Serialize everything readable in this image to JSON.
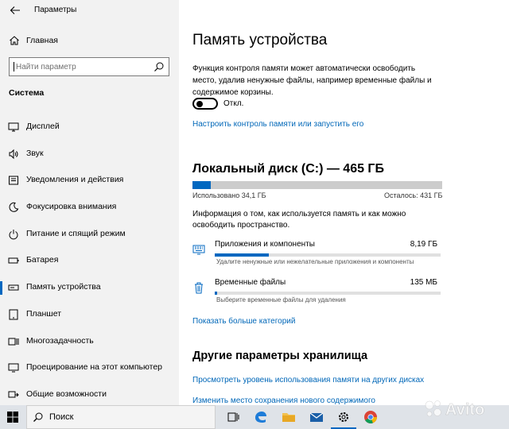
{
  "window": {
    "title": "Параметры"
  },
  "sidebar": {
    "home_label": "Главная",
    "search_placeholder": "Найти параметр",
    "section_label": "Система",
    "items": [
      {
        "label": "Дисплей",
        "icon": "display-icon"
      },
      {
        "label": "Звук",
        "icon": "speaker-icon"
      },
      {
        "label": "Уведомления и действия",
        "icon": "notification-icon"
      },
      {
        "label": "Фокусировка внимания",
        "icon": "moon-icon"
      },
      {
        "label": "Питание и спящий режим",
        "icon": "power-icon"
      },
      {
        "label": "Батарея",
        "icon": "battery-icon"
      },
      {
        "label": "Память устройства",
        "icon": "storage-icon",
        "active": true
      },
      {
        "label": "Планшет",
        "icon": "tablet-icon"
      },
      {
        "label": "Многозадачность",
        "icon": "multitask-icon"
      },
      {
        "label": "Проецирование на этот компьютер",
        "icon": "project-icon"
      },
      {
        "label": "Общие возможности",
        "icon": "shared-icon"
      }
    ]
  },
  "main": {
    "title": "Память устройства",
    "description": "Функция контроля памяти может автоматически освободить место, удалив ненужные файлы, например временные файлы и содержимое корзины.",
    "toggle": {
      "state": "off",
      "label": "Откл."
    },
    "configure_link": "Настроить контроль памяти или запустить его",
    "disk": {
      "title": "Локальный диск (C:) — 465 ГБ",
      "used_label": "Использовано 34,1 ГБ",
      "free_label": "Осталось: 431 ГБ",
      "used_fraction": 0.073
    },
    "info": "Информация о том, как используется память и как можно освободить пространство.",
    "categories": [
      {
        "name": "Приложения и компоненты",
        "size": "8,19 ГБ",
        "sub": "Удалите ненужные или нежелательные приложения и компоненты",
        "fraction": 0.24,
        "icon": "apps-icon"
      },
      {
        "name": "Временные файлы",
        "size": "135 МБ",
        "sub": "Выберите временные файлы для удаления",
        "fraction": 0.01,
        "icon": "trash-icon"
      }
    ],
    "more_link": "Показать больше категорий",
    "other_title": "Другие параметры хранилища",
    "other_links": [
      "Просмотреть уровень использования памяти на других дисках",
      "Изменить место сохранения нового содержимого"
    ]
  },
  "taskbar": {
    "search_label": "Поиск",
    "icons": [
      "task-view-icon",
      "edge-icon",
      "file-explorer-icon",
      "mail-icon",
      "settings-icon",
      "chrome-icon"
    ]
  },
  "watermark": {
    "text": "Avito"
  },
  "colors": {
    "accent": "#0067c0",
    "link": "#0067b8",
    "sidebar_bg": "#f2f2f2"
  }
}
